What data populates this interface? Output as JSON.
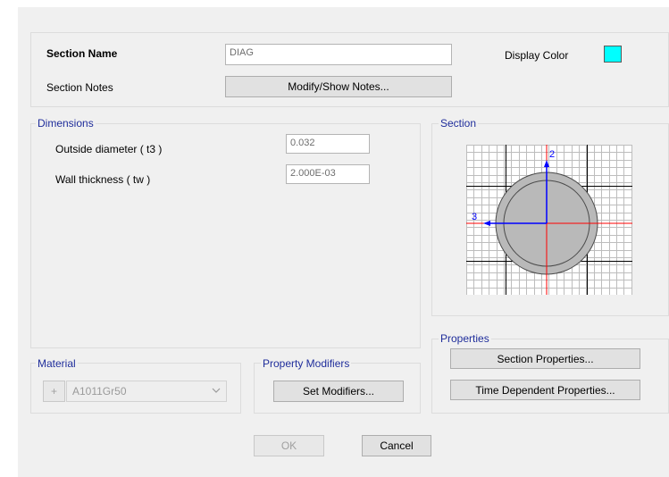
{
  "section_name": {
    "label": "Section Name",
    "value": "DIAG"
  },
  "section_notes": {
    "label": "Section Notes",
    "button": "Modify/Show Notes..."
  },
  "display_color": {
    "label": "Display Color",
    "color": "#00ffff"
  },
  "dimensions": {
    "title": "Dimensions",
    "outside_diameter": {
      "label": "Outside diameter  ( t3 )",
      "value": "0.032"
    },
    "wall_thickness": {
      "label": "Wall thickness  ( tw )",
      "value": "2.000E-03"
    }
  },
  "section_preview": {
    "title": "Section",
    "axis2_label": "2",
    "axis3_label": "3",
    "colors": {
      "grid": "#b8b8b8",
      "major": "#000000",
      "axis_red": "#ff0000",
      "axis_blue": "#0000ff",
      "ring": "#c0c0c0"
    }
  },
  "properties": {
    "title": "Properties",
    "section_properties": "Section Properties...",
    "time_dependent": "Time Dependent Properties..."
  },
  "material": {
    "title": "Material",
    "plus": "+",
    "value": "A1011Gr50"
  },
  "property_modifiers": {
    "title": "Property Modifiers",
    "button": "Set Modifiers..."
  },
  "footer": {
    "ok": "OK",
    "cancel": "Cancel"
  }
}
